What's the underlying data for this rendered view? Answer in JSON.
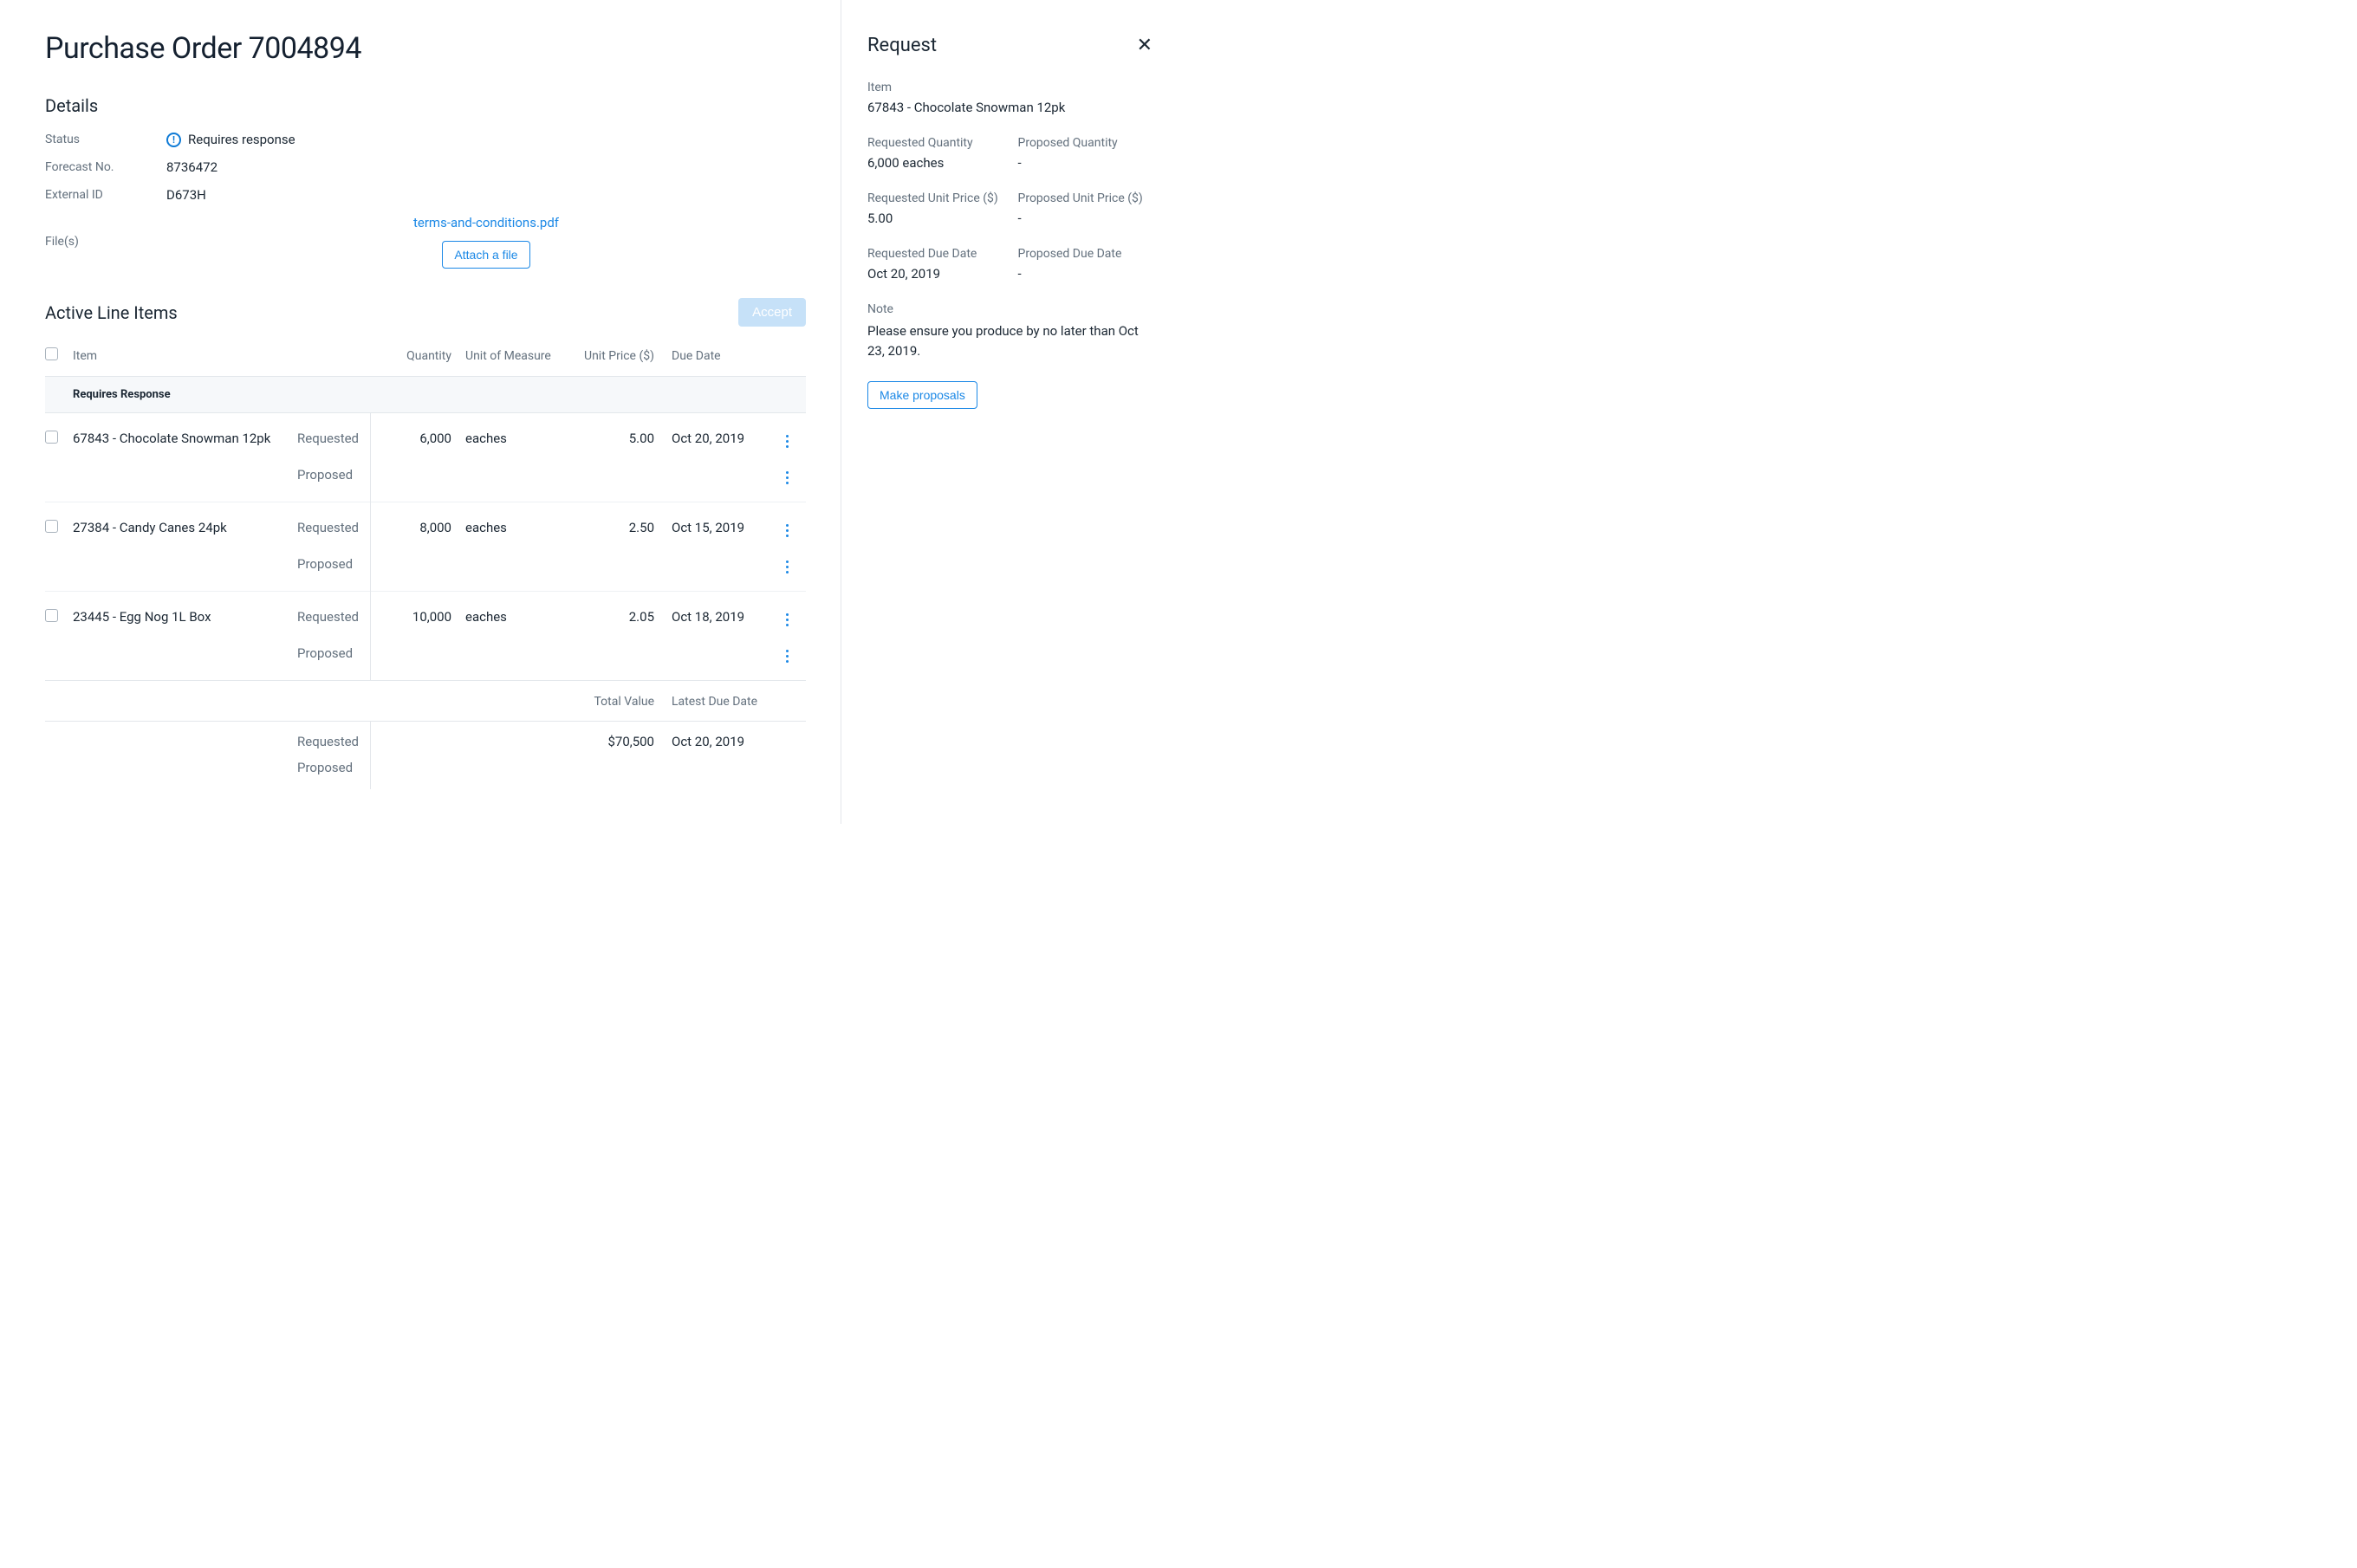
{
  "page": {
    "title": "Purchase Order 7004894"
  },
  "details": {
    "heading": "Details",
    "status_label": "Status",
    "status_value": "Requires response",
    "forecast_label": "Forecast No.",
    "forecast_value": "8736472",
    "external_id_label": "External ID",
    "external_id_value": "D673H",
    "files_label": "File(s)",
    "file_link": "terms-and-conditions.pdf",
    "attach_button": "Attach a file"
  },
  "line_items": {
    "heading": "Active Line Items",
    "accept_button": "Accept",
    "columns": {
      "item": "Item",
      "quantity": "Quantity",
      "uom": "Unit of Measure",
      "unit_price": "Unit Price ($)",
      "due_date": "Due Date"
    },
    "group_label": "Requires Response",
    "kind_requested": "Requested",
    "kind_proposed": "Proposed",
    "rows": [
      {
        "item": "67843 - Chocolate Snowman 12pk",
        "quantity": "6,000",
        "uom": "eaches",
        "unit_price": "5.00",
        "due_date": "Oct 20, 2019"
      },
      {
        "item": "27384 - Candy Canes 24pk",
        "quantity": "8,000",
        "uom": "eaches",
        "unit_price": "2.50",
        "due_date": "Oct 15, 2019"
      },
      {
        "item": "23445 - Egg Nog 1L Box",
        "quantity": "10,000",
        "uom": "eaches",
        "unit_price": "2.05",
        "due_date": "Oct 18, 2019"
      }
    ],
    "summary": {
      "total_label": "Total Value",
      "latest_label": "Latest Due Date",
      "total_value": "$70,500",
      "latest_value": "Oct 20, 2019"
    }
  },
  "request": {
    "heading": "Request",
    "item_label": "Item",
    "item_value": "67843 - Chocolate Snowman 12pk",
    "req_qty_label": "Requested Quantity",
    "req_qty_value": "6,000 eaches",
    "prop_qty_label": "Proposed Quantity",
    "prop_qty_value": "-",
    "req_price_label": "Requested Unit Price ($)",
    "req_price_value": "5.00",
    "prop_price_label": "Proposed Unit Price ($)",
    "prop_price_value": "-",
    "req_due_label": "Requested Due Date",
    "req_due_value": "Oct 20, 2019",
    "prop_due_label": "Proposed Due Date",
    "prop_due_value": "-",
    "note_label": "Note",
    "note_value": "Please ensure you produce by no later than Oct 23, 2019.",
    "make_proposals_button": "Make proposals"
  }
}
